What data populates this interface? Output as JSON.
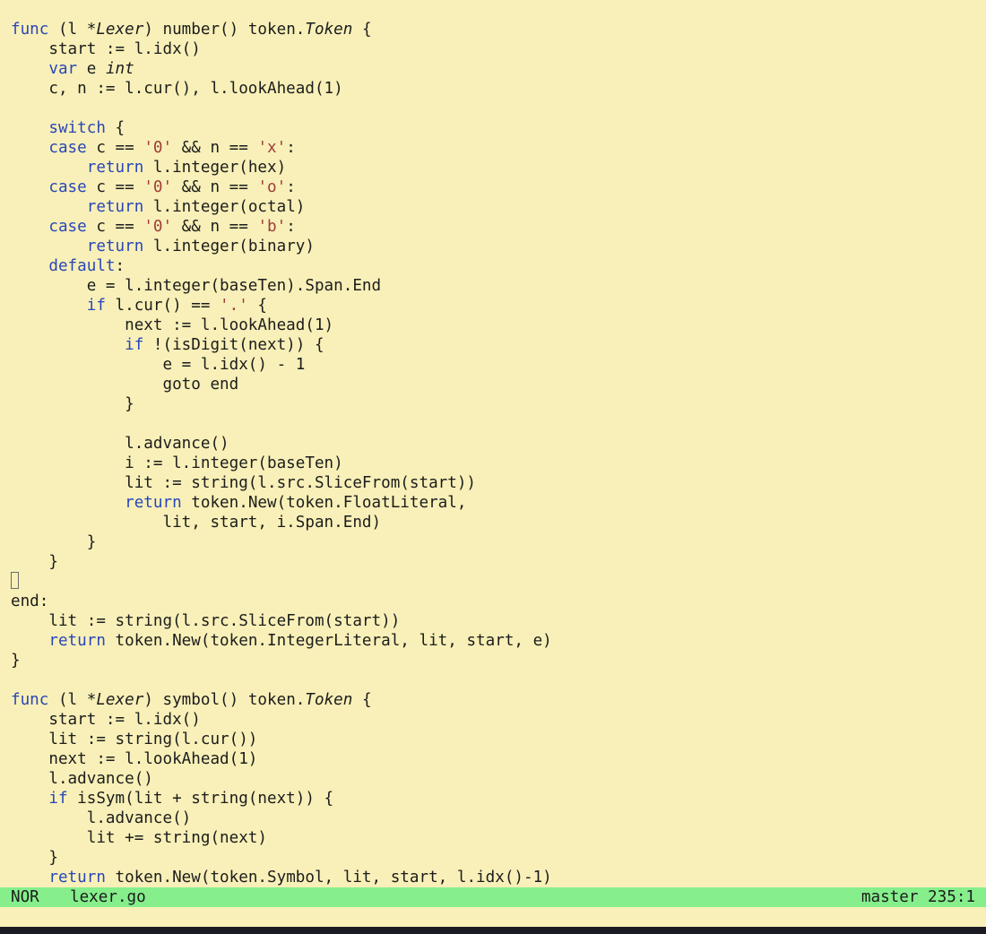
{
  "app": {
    "name": "helix-editor"
  },
  "colors": {
    "background": "#f8f0b8",
    "keyword": "#2a46b8",
    "string": "#a03c3c",
    "text": "#1c1c1c",
    "statusline": "#86ef8c"
  },
  "editor": {
    "lines": [
      [
        {
          "t": "func",
          "c": "kw"
        },
        {
          "t": " (l *"
        },
        {
          "t": "Lexer",
          "c": "ty"
        },
        {
          "t": ") number() token."
        },
        {
          "t": "Token",
          "c": "ty"
        },
        {
          "t": " {"
        }
      ],
      [
        {
          "t": "    start := l.idx()"
        }
      ],
      [
        {
          "t": "    "
        },
        {
          "t": "var",
          "c": "kw"
        },
        {
          "t": " e "
        },
        {
          "t": "int",
          "c": "ty"
        }
      ],
      [
        {
          "t": "    c, n := l.cur(), l.lookAhead(1)"
        }
      ],
      [],
      [
        {
          "t": "    "
        },
        {
          "t": "switch",
          "c": "kw"
        },
        {
          "t": " {"
        }
      ],
      [
        {
          "t": "    "
        },
        {
          "t": "case",
          "c": "kw"
        },
        {
          "t": " c == "
        },
        {
          "t": "'0'",
          "c": "str"
        },
        {
          "t": " && n == "
        },
        {
          "t": "'x'",
          "c": "str"
        },
        {
          "t": ":"
        }
      ],
      [
        {
          "t": "        "
        },
        {
          "t": "return",
          "c": "kw"
        },
        {
          "t": " l.integer(hex)"
        }
      ],
      [
        {
          "t": "    "
        },
        {
          "t": "case",
          "c": "kw"
        },
        {
          "t": " c == "
        },
        {
          "t": "'0'",
          "c": "str"
        },
        {
          "t": " && n == "
        },
        {
          "t": "'o'",
          "c": "str"
        },
        {
          "t": ":"
        }
      ],
      [
        {
          "t": "        "
        },
        {
          "t": "return",
          "c": "kw"
        },
        {
          "t": " l.integer(octal)"
        }
      ],
      [
        {
          "t": "    "
        },
        {
          "t": "case",
          "c": "kw"
        },
        {
          "t": " c == "
        },
        {
          "t": "'0'",
          "c": "str"
        },
        {
          "t": " && n == "
        },
        {
          "t": "'b'",
          "c": "str"
        },
        {
          "t": ":"
        }
      ],
      [
        {
          "t": "        "
        },
        {
          "t": "return",
          "c": "kw"
        },
        {
          "t": " l.integer(binary)"
        }
      ],
      [
        {
          "t": "    "
        },
        {
          "t": "default",
          "c": "kw"
        },
        {
          "t": ":"
        }
      ],
      [
        {
          "t": "        e = l.integer(baseTen).Span.End"
        }
      ],
      [
        {
          "t": "        "
        },
        {
          "t": "if",
          "c": "kw"
        },
        {
          "t": " l.cur() == "
        },
        {
          "t": "'.'",
          "c": "str"
        },
        {
          "t": " {"
        }
      ],
      [
        {
          "t": "            next := l.lookAhead(1)"
        }
      ],
      [
        {
          "t": "            "
        },
        {
          "t": "if",
          "c": "kw"
        },
        {
          "t": " !(isDigit(next)) {"
        }
      ],
      [
        {
          "t": "                e = l.idx() - 1"
        }
      ],
      [
        {
          "t": "                goto end"
        }
      ],
      [
        {
          "t": "            }"
        }
      ],
      [],
      [
        {
          "t": "            l.advance()"
        }
      ],
      [
        {
          "t": "            i := l.integer(baseTen)"
        }
      ],
      [
        {
          "t": "            lit := string(l.src.SliceFrom(start))"
        }
      ],
      [
        {
          "t": "            "
        },
        {
          "t": "return",
          "c": "kw"
        },
        {
          "t": " token.New(token.FloatLiteral,"
        }
      ],
      [
        {
          "t": "                lit, start, i.Span.End)"
        }
      ],
      [
        {
          "t": "        }"
        }
      ],
      [
        {
          "t": "    }"
        }
      ],
      [
        {
          "cursor": true
        }
      ],
      [
        {
          "t": "end:"
        }
      ],
      [
        {
          "t": "    lit := string(l.src.SliceFrom(start))"
        }
      ],
      [
        {
          "t": "    "
        },
        {
          "t": "return",
          "c": "kw"
        },
        {
          "t": " token.New(token.IntegerLiteral, lit, start, e)"
        }
      ],
      [
        {
          "t": "}"
        }
      ],
      [],
      [
        {
          "t": "func",
          "c": "kw"
        },
        {
          "t": " (l *"
        },
        {
          "t": "Lexer",
          "c": "ty"
        },
        {
          "t": ") symbol() token."
        },
        {
          "t": "Token",
          "c": "ty"
        },
        {
          "t": " {"
        }
      ],
      [
        {
          "t": "    start := l.idx()"
        }
      ],
      [
        {
          "t": "    lit := string(l.cur())"
        }
      ],
      [
        {
          "t": "    next := l.lookAhead(1)"
        }
      ],
      [
        {
          "t": "    l.advance()"
        }
      ],
      [
        {
          "t": "    "
        },
        {
          "t": "if",
          "c": "kw"
        },
        {
          "t": " isSym(lit + string(next)) {"
        }
      ],
      [
        {
          "t": "        l.advance()"
        }
      ],
      [
        {
          "t": "        lit += string(next)"
        }
      ],
      [
        {
          "t": "    }"
        }
      ],
      [
        {
          "t": "    "
        },
        {
          "t": "return",
          "c": "kw"
        },
        {
          "t": " token.New(token.Symbol, lit, start, l.idx()-1)"
        }
      ]
    ]
  },
  "statusline": {
    "mode": "NOR",
    "filename": "lexer.go",
    "branch_position": "master 235:1"
  }
}
